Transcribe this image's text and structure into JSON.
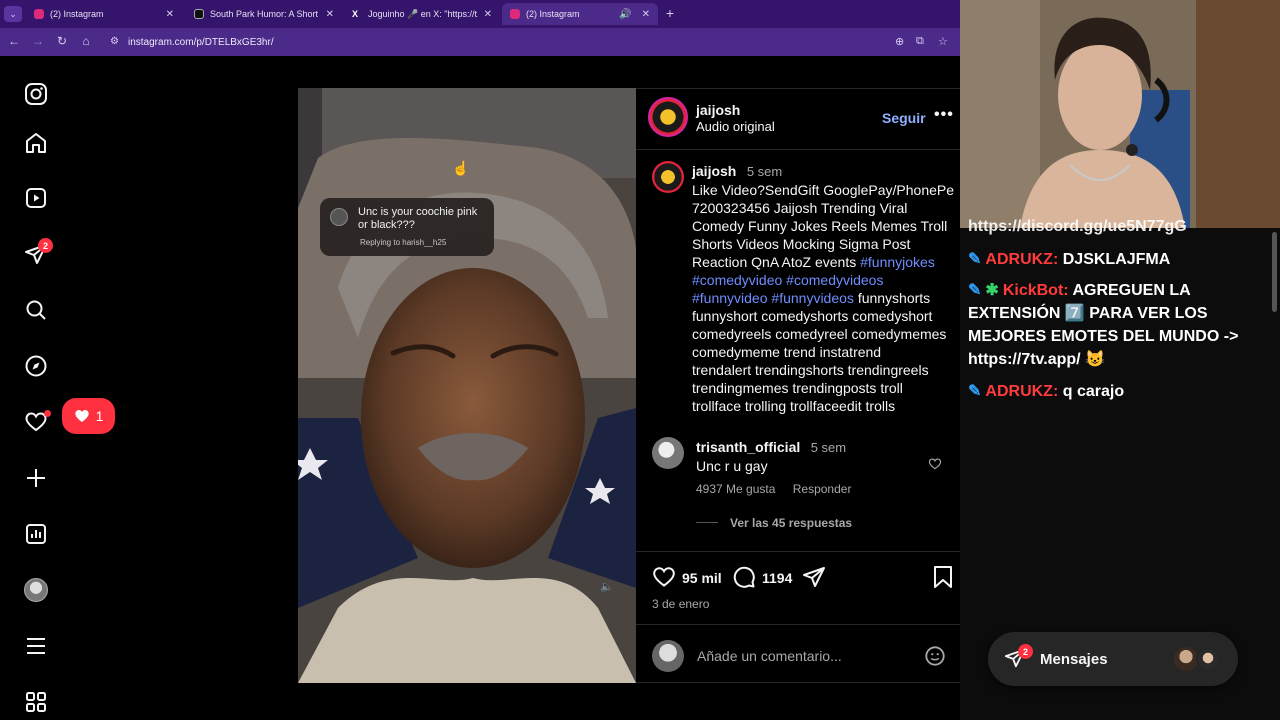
{
  "browser": {
    "tabs": [
      {
        "title": "(2) Instagram",
        "favicon": "instagram-icon",
        "color": "#dd2a7b"
      },
      {
        "title": "South Park Humor: A Short Refl",
        "favicon": "tiktok-icon",
        "color": "#111111"
      },
      {
        "title": "Joguinho 🎤 en X: \"https://t.co/",
        "favicon": "x-icon",
        "color": "#111111"
      },
      {
        "title": "(2) Instagram",
        "favicon": "instagram-icon",
        "color": "#dd2a7b"
      }
    ],
    "url": "instagram.com/p/DTELBxGE3hr/"
  },
  "sidebar": {
    "notification_badge": "2",
    "likes_count": "1"
  },
  "video": {
    "reply_text": "Unc is your coochie pink or black???",
    "replying_to": "Replying to harish__h25"
  },
  "post": {
    "username": "jaijosh",
    "audio": "Audio original",
    "follow": "Seguir",
    "caption_time": "5 sem",
    "caption_lines": [
      "Like Video?SendGift GooglePay/PhonePe",
      "7200323456 Jaijosh Trending Viral",
      "Comedy Funny Jokes Reels Memes Troll",
      "Shorts Videos Mocking Sigma Post"
    ],
    "caption_line5_text": "Reaction QnA AtoZ events ",
    "tags": [
      "#funnyjokes",
      "#comedyvideo",
      "#comedyvideos",
      "#funnyvideo",
      "#funnyvideos"
    ],
    "caption_line7_tail": "funnyshorts",
    "caption_tail_lines": [
      "funnyshort comedyshorts comedyshort",
      "comedyreels comedyreel comedymemes",
      "comedymeme trend instatrend",
      "trendalert trendingshorts trendingreels",
      "trendingmemes trendingposts troll",
      "trollface trolling trollfaceedit trolls"
    ],
    "comment": {
      "user": "trisanth_official",
      "time": "5 sem",
      "text": "Unc r u gay",
      "likes": "4937 Me gusta",
      "reply": "Responder",
      "view_replies": "Ver las 45 respuestas"
    },
    "like_count": "95 mil",
    "comment_count": "1194",
    "date": "3 de enero",
    "add_comment_placeholder": "Añade un comentario..."
  },
  "chat": {
    "top_cut": "https://discord.gg/ue5N77gG",
    "lines": [
      {
        "nick": "ADRUKZ:",
        "text": "DJSKLAJFMA"
      },
      {
        "nick": "KickBot:",
        "text": "AGREGUEN LA EXTENSIÓN 7️⃣ PARA VER LOS MEJORES EMOTES DEL MUNDO -> https://7tv.app/ 😺"
      },
      {
        "nick": "ADRUKZ:",
        "text": "q carajo"
      }
    ]
  },
  "messages": {
    "label": "Mensajes",
    "badge": "2"
  },
  "colors": {
    "tabbar": "#35156b",
    "addressbar": "#4c2a8a",
    "follow_blue": "#0095f6",
    "hashtag": "#6f8dff",
    "badge_red": "#ff3040",
    "chat_nick": "#ff3b3b"
  }
}
